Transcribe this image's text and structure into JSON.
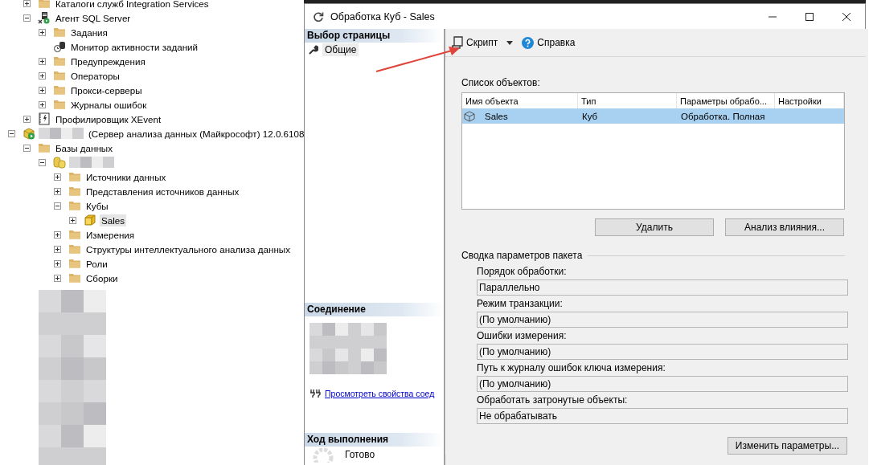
{
  "tree": [
    {
      "children": [
        {
          "label": "Каталоги служб Integration Services",
          "kind": "folder",
          "expanded": false,
          "selected": false
        },
        {
          "label": "Агент SQL Server",
          "kind": "agent",
          "expanded": true,
          "selected": false,
          "children": [
            {
              "label": "Задания",
              "kind": "folder",
              "expanded": false,
              "selected": false
            },
            {
              "label": "Монитор активности заданий",
              "kind": "monitor",
              "selected": false
            },
            {
              "label": "Предупреждения",
              "kind": "folder",
              "expanded": false,
              "selected": false
            },
            {
              "label": "Операторы",
              "kind": "folder",
              "expanded": false,
              "selected": false
            },
            {
              "label": "Прокси-серверы",
              "kind": "folder",
              "expanded": false,
              "selected": false
            },
            {
              "label": "Журналы ошибок",
              "kind": "folder",
              "expanded": false,
              "selected": false
            }
          ]
        },
        {
          "label": "Профилировщик XEvent",
          "kind": "xevent",
          "expanded": false,
          "selected": false
        }
      ]
    },
    {
      "label": "(Сервер анализа данных (Майкрософт) 12.0.6108",
      "kind": "server",
      "name_hidden": true,
      "expanded": true,
      "selected": false,
      "children": [
        {
          "label": "Базы данных",
          "kind": "folder",
          "expanded": true,
          "selected": false,
          "children": [
            {
              "kind": "database",
              "name_hidden": true,
              "expanded": true,
              "selected": false,
              "children": [
                {
                  "label": "Источники данных",
                  "kind": "folder",
                  "expanded": false,
                  "selected": false
                },
                {
                  "label": "Представления источников данных",
                  "kind": "folder",
                  "expanded": false,
                  "selected": false
                },
                {
                  "label": "Кубы",
                  "kind": "folder",
                  "expanded": true,
                  "selected": false,
                  "children": [
                    {
                      "label": "Sales",
                      "kind": "cube",
                      "expanded": false,
                      "selected": true
                    }
                  ]
                },
                {
                  "label": "Измерения",
                  "kind": "folder",
                  "expanded": false,
                  "selected": false
                },
                {
                  "label": "Структуры интеллектуального анализа данных",
                  "kind": "folder",
                  "expanded": false,
                  "selected": false
                },
                {
                  "label": "Роли",
                  "kind": "folder",
                  "expanded": false,
                  "selected": false
                },
                {
                  "label": "Сборки",
                  "kind": "folder",
                  "expanded": false,
                  "selected": false
                }
              ]
            }
          ]
        }
      ]
    }
  ],
  "dialog": {
    "title": "Обработка Куб - Sales",
    "pages_header": "Выбор страницы",
    "pages": [
      {
        "label": "Общие",
        "selected": true
      }
    ],
    "connection": {
      "header": "Соединение",
      "link": "Просмотреть свойства соед"
    },
    "progress": {
      "header": "Ход выполнения",
      "status": "Готово"
    },
    "toolbar": [
      {
        "kind": "script",
        "label": "Скрипт"
      },
      {
        "kind": "dropdown"
      },
      {
        "kind": "help",
        "label": "Справка"
      }
    ],
    "objects": {
      "label": "Список объектов:",
      "columns": [
        "Имя объекта",
        "Тип",
        "Параметры обрабо...",
        "Настройки"
      ],
      "rows": [
        {
          "cells": [
            "Sales",
            "Куб",
            "Обработка. Полная"
          ],
          "selected": true
        }
      ]
    },
    "object_buttons": [
      "Удалить",
      "Анализ влияния..."
    ],
    "summary": {
      "title": "Сводка параметров пакета",
      "fields": [
        {
          "label": "Порядок обработки:",
          "value": "Параллельно"
        },
        {
          "label": "Режим транзакции:",
          "value": "(По умолчанию)"
        },
        {
          "label": "Ошибки измерения:",
          "value": "(По умолчанию)"
        },
        {
          "label": "Путь к журналу ошибок ключа измерения:",
          "value": "(По умолчанию)"
        },
        {
          "label": "Обработать затронутые объекты:",
          "value": "Не обрабатывать"
        }
      ]
    },
    "change_button": "Изменить параметры..."
  }
}
